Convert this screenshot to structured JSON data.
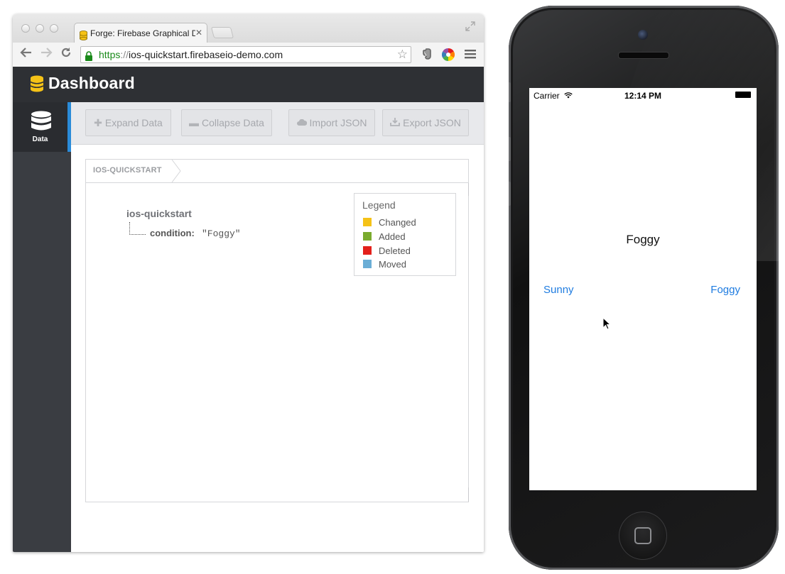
{
  "browser": {
    "tab_title": "Forge: Firebase Graphical D",
    "tab_close": "✕",
    "url": {
      "scheme": "https",
      "separator": "://",
      "host": "ios-quickstart.firebaseio-demo.com"
    }
  },
  "dashboard": {
    "title": "Dashboard",
    "sidebar": {
      "items": [
        {
          "label": "Data",
          "icon": "database-icon"
        }
      ]
    },
    "actions": {
      "expand": "Expand Data",
      "collapse": "Collapse Data",
      "import": "Import JSON",
      "export": "Export JSON"
    },
    "breadcrumb": "IOS-QUICKSTART",
    "tree": {
      "root": "ios-quickstart",
      "children": [
        {
          "key": "condition:",
          "value": "\"Foggy\""
        }
      ]
    },
    "legend": {
      "title": "Legend",
      "items": [
        {
          "label": "Changed",
          "color": "#f5c217"
        },
        {
          "label": "Added",
          "color": "#7aab2e"
        },
        {
          "label": "Deleted",
          "color": "#e3201b"
        },
        {
          "label": "Moved",
          "color": "#6baed6"
        }
      ]
    }
  },
  "phone": {
    "carrier": "Carrier",
    "time": "12:14 PM",
    "condition": "Foggy",
    "buttons": {
      "sunny": "Sunny",
      "foggy": "Foggy"
    }
  },
  "colors": {
    "accent_blue": "#2a8bd9",
    "ios_blue": "#1f7ce0",
    "header_dark": "#2e3034",
    "firebase_yellow": "#f5c217"
  }
}
